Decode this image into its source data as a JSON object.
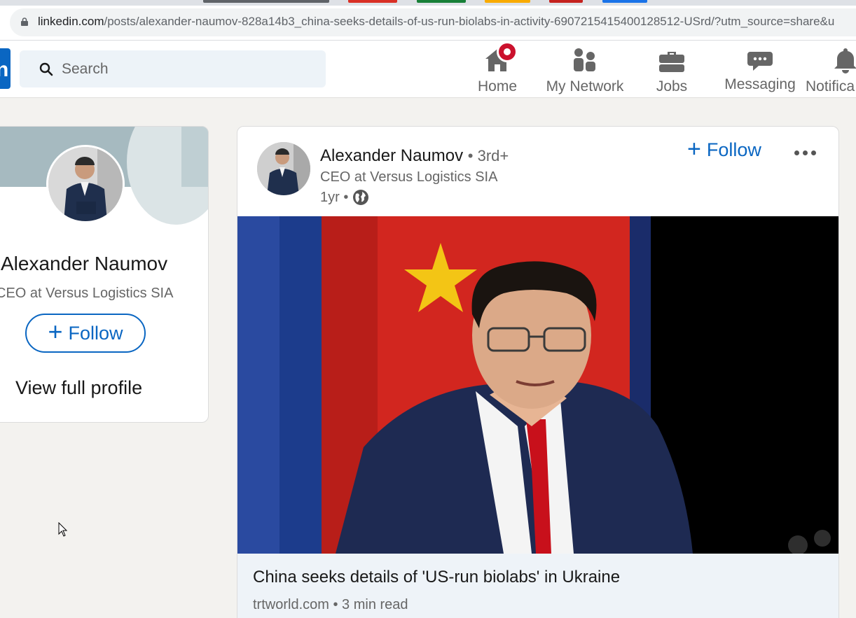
{
  "browser": {
    "url_host": "linkedin.com",
    "url_path": "/posts/alexander-naumov-828a14b3_china-seeks-details-of-us-run-biolabs-in-activity-6907215415400128512-USrd/?utm_source=share&u",
    "tab_colors": [
      "#5f6368",
      "#d93025",
      "#188038",
      "#f9ab00",
      "#c5221f",
      "#1a73e8"
    ]
  },
  "header": {
    "search_placeholder": "Search",
    "nav": [
      {
        "label": "Home",
        "icon": "home-icon"
      },
      {
        "label": "My Network",
        "icon": "network-icon"
      },
      {
        "label": "Jobs",
        "icon": "briefcase-icon"
      },
      {
        "label": "Messaging",
        "icon": "messaging-icon"
      },
      {
        "label": "Notifica",
        "icon": "bell-icon"
      }
    ]
  },
  "profile_card": {
    "name": "Alexander Naumov",
    "headline": "CEO at Versus Logistics SIA",
    "follow_label": "Follow",
    "view_profile_label": "View full profile"
  },
  "post": {
    "author_name": "Alexander Naumov",
    "degree": "• 3rd+",
    "headline": "CEO at Versus Logistics SIA",
    "time": "1yr •",
    "follow_label": "Follow",
    "article": {
      "title": "China seeks details of 'US-run biolabs' in Ukraine",
      "source": "trtworld.com",
      "read_time": "3 min read"
    }
  },
  "colors": {
    "brand": "#0a66c2",
    "badge": "#cb112d",
    "page_bg": "#f3f2ef"
  }
}
